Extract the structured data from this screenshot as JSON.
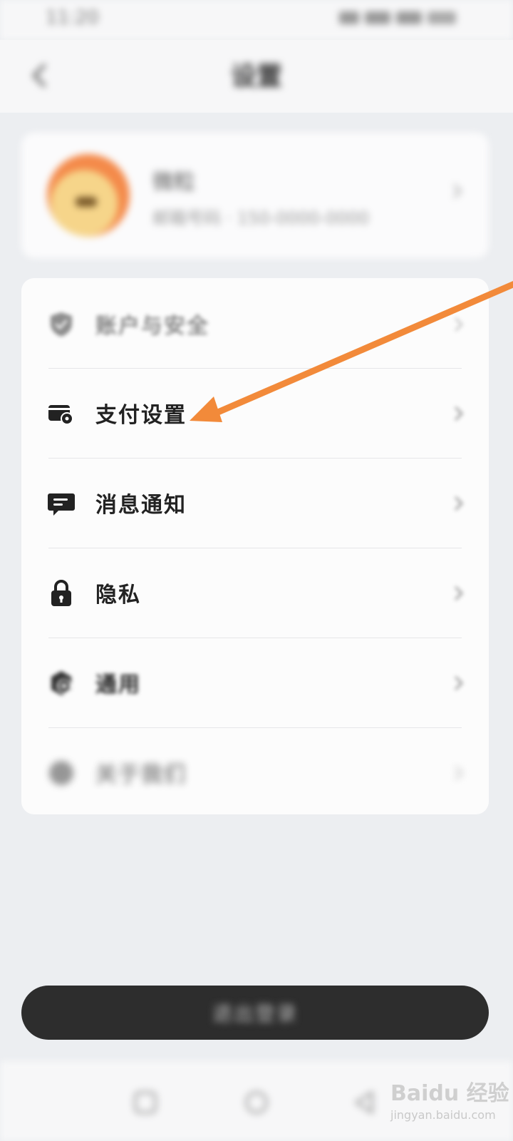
{
  "status_bar": {
    "time": "11:20"
  },
  "header": {
    "title": "设置",
    "back_icon": "chevron-left-icon"
  },
  "profile": {
    "name": "微粒",
    "subtitle": "邮箱号码 · 150-0000-0000"
  },
  "settings": {
    "items": [
      {
        "label": "账户与安全",
        "icon": "shield-check-icon"
      },
      {
        "label": "支付设置",
        "icon": "wallet-gear-icon"
      },
      {
        "label": "消息通知",
        "icon": "chat-bubble-icon"
      },
      {
        "label": "隐私",
        "icon": "lock-icon"
      },
      {
        "label": "通用",
        "icon": "gear-icon"
      },
      {
        "label": "关于我们",
        "icon": "info-icon"
      }
    ]
  },
  "logout": {
    "label": "退出登录"
  },
  "bottom_nav": {
    "items": [
      "square-icon",
      "circle-icon",
      "back-triangle-icon"
    ]
  },
  "watermark": {
    "brand": "Baidu 经验",
    "url": "jingyan.baidu.com"
  },
  "annotation": {
    "arrow_color": "#f28a3a"
  },
  "colors": {
    "background": "#eceef1",
    "card": "#fcfcfc",
    "logout_button": "#2d2d2d",
    "text": "#222222"
  }
}
